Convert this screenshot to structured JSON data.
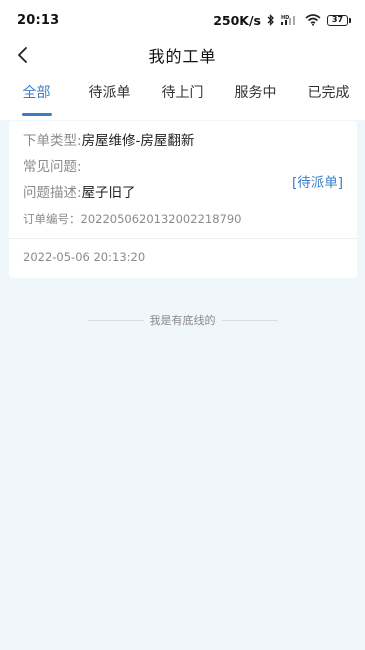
{
  "status_bar": {
    "time": "20:13",
    "network_speed": "250K/s",
    "battery_level": "37",
    "icons": [
      "bluetooth-icon",
      "hd-icon",
      "signal-icon",
      "wifi-icon",
      "battery-icon"
    ]
  },
  "header": {
    "title": "我的工单",
    "back_icon": "chevron-left-icon"
  },
  "tabs": [
    {
      "label": "全部",
      "active": true
    },
    {
      "label": "待派单",
      "active": false
    },
    {
      "label": "待上门",
      "active": false
    },
    {
      "label": "服务中",
      "active": false
    },
    {
      "label": "已完成",
      "active": false
    }
  ],
  "order": {
    "type_label": "下单类型:",
    "type_value": "房屋维修-房屋翻新",
    "issue_label": "常见问题:",
    "issue_value": "",
    "desc_label": "问题描述:",
    "desc_value": "屋子旧了",
    "number_label": "订单编号：",
    "number_value": "20220506201320022187​90",
    "status": "[待派单]",
    "created_at": "2022-05-06 20:13:20"
  },
  "footer": {
    "end_text": "我是有底线的"
  },
  "colors": {
    "accent": "#3b7ec8",
    "background": "#f0f7fa"
  }
}
